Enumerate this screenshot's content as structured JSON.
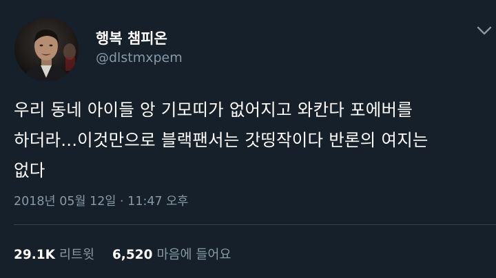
{
  "user": {
    "display_name": "행복 챔피온",
    "handle": "@dlstmxpem",
    "avatar_icon": "profile-photo"
  },
  "menu": {
    "icon": "chevron-down-icon"
  },
  "tweet": {
    "lines": [
      "우리 동네 아이들 앙 기모띠가 없어지고 와칸다 포에버를",
      "하더라...이것만으로 블랙팬서는 갓띵작이다 반론의 여지는",
      "없다"
    ],
    "timestamp": "2018년 05월 12일 · 11:47 오후"
  },
  "stats": {
    "retweets": {
      "count": "29.1K",
      "label": "리트윗"
    },
    "likes": {
      "count": "6,520",
      "label": "마음에 들어요"
    }
  },
  "colors": {
    "background": "#15202b",
    "primary_text": "#ffffff",
    "secondary_text": "#8899a6",
    "divider": "#38444d"
  }
}
